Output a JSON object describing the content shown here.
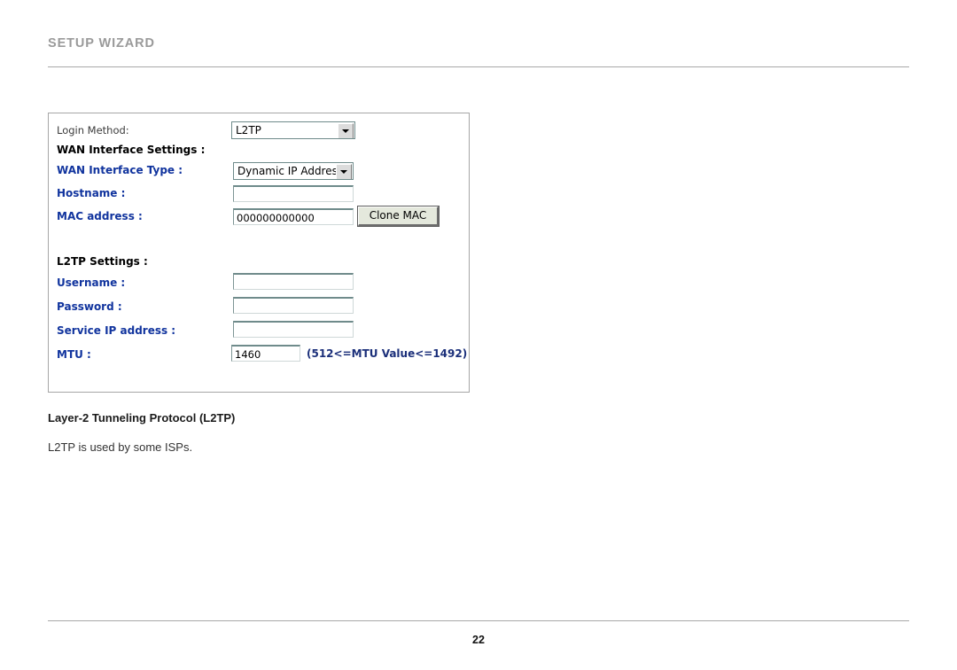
{
  "header": {
    "title": "SETUP WIZARD"
  },
  "panel": {
    "login_method": {
      "label": "Login Method:",
      "value": "L2TP"
    },
    "wan_section": {
      "heading": "WAN Interface Settings :",
      "interface_type": {
        "label": "WAN Interface Type :",
        "value": "Dynamic IP Address"
      },
      "hostname": {
        "label": "Hostname :",
        "value": ""
      },
      "mac_address": {
        "label": "MAC address :",
        "value": "000000000000",
        "clone_button": "Clone MAC"
      }
    },
    "l2tp_section": {
      "heading": "L2TP Settings :",
      "username": {
        "label": "Username :",
        "value": ""
      },
      "password": {
        "label": "Password :",
        "value": ""
      },
      "service_ip": {
        "label": "Service IP address :",
        "value": ""
      },
      "mtu": {
        "label": "MTU :",
        "value": "1460",
        "hint": "(512<=MTU Value<=1492)"
      }
    }
  },
  "caption": {
    "title": "Layer-2 Tunneling Protocol (L2TP)",
    "body": "L2TP is used by some ISPs."
  },
  "footer": {
    "page_number": "22"
  },
  "colors": {
    "header_gray": "#9a9a9a",
    "label_blue": "#11349e",
    "hint_blue": "#1b2f7a",
    "panel_border": "#a6a6a6",
    "button_face": "#e4e8dc"
  }
}
